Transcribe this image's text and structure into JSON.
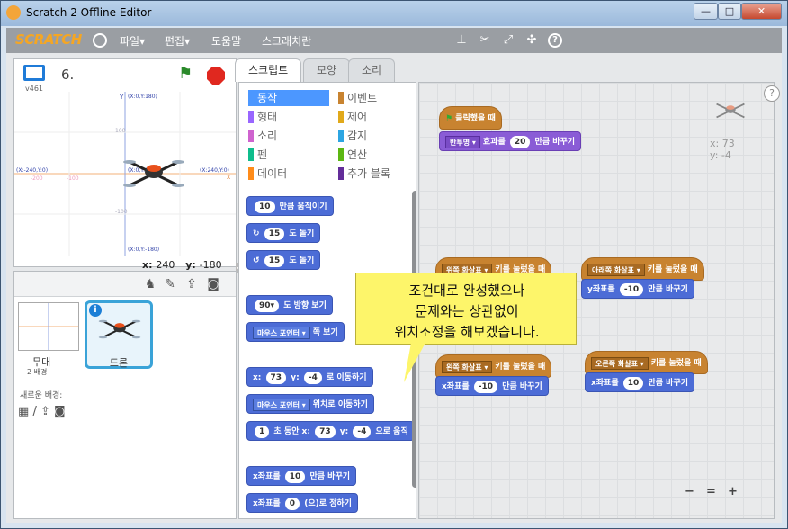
{
  "window": {
    "title": "Scratch 2 Offline Editor",
    "minimize": "—",
    "maximize": "□",
    "close": "✕"
  },
  "menubar": {
    "logo": "SCRATCH",
    "menus": [
      "파일▾",
      "편집▾",
      "도움말",
      "스크래치란"
    ],
    "tool_icons": [
      "stamp-icon",
      "cut-icon",
      "grow-icon",
      "shrink-icon",
      "help-icon"
    ]
  },
  "stage": {
    "version": "v461",
    "project_title": "6.",
    "axis_labels": {
      "top": "(X:0,Y:180)",
      "bottom": "(X:0,Y:-180)",
      "left": "(X:-240,Y:0)",
      "right": "(X:240,Y:0)",
      "center": "(X:0,Y:0)",
      "x_letter": "X",
      "y_letter": "Y",
      "tick_100": "100",
      "tick_n100": "-100",
      "tick_200": "-200"
    },
    "x_label": "x:",
    "x_value": "240",
    "y_label": "y:",
    "y_value": "-180"
  },
  "sprites": {
    "stage_label": "무대",
    "backdrop_count": "2 배경",
    "new_backdrop_label": "새로운 배경:",
    "sprite_name": "드론",
    "info": "i"
  },
  "tabs": [
    "스크립트",
    "모양",
    "소리"
  ],
  "categories": {
    "left": [
      {
        "label": "동작",
        "color": "#4c97ff"
      },
      {
        "label": "형태",
        "color": "#9966ff"
      },
      {
        "label": "소리",
        "color": "#cf63cf"
      },
      {
        "label": "펜",
        "color": "#0fbd8c"
      },
      {
        "label": "데이터",
        "color": "#ff8c1a"
      }
    ],
    "right": [
      {
        "label": "이벤트",
        "color": "#c88330"
      },
      {
        "label": "제어",
        "color": "#e1a91a"
      },
      {
        "label": "감지",
        "color": "#2ca5e2"
      },
      {
        "label": "연산",
        "color": "#5cb712"
      },
      {
        "label": "추가 블록",
        "color": "#632d99"
      }
    ]
  },
  "palette_blocks": {
    "move_num": "10",
    "move_text": "만큼 움직이기",
    "turn_cw_num": "15",
    "turn_cw_text": "도 돌기",
    "turn_ccw_num": "15",
    "turn_ccw_text": "도 돌기",
    "point_dir_num": "90▾",
    "point_dir_text": "도 방향 보기",
    "point_to_drop": "마우스 포인터 ▾",
    "point_to_text": "쪽 보기",
    "goto_x_label": "x:",
    "goto_x": "73",
    "goto_y_label": "y:",
    "goto_y": "-4",
    "goto_text": "로 이동하기",
    "goto_to_drop": "마우스 포인터 ▾",
    "goto_to_text": "위치로 이동하기",
    "glide_num": "1",
    "glide_text1": "초 동안 x:",
    "glide_x": "73",
    "glide_y_label": "y:",
    "glide_y": "-4",
    "glide_text2": "으로 움직",
    "change_x_text1": "x좌표를",
    "change_x_num": "10",
    "change_x_text2": "만큼 바꾸기",
    "set_x_text1": "x좌표를",
    "set_x_num": "0",
    "set_x_text2": "(으)로 정하기"
  },
  "scripts": {
    "flag_hat": "클릭했을 때",
    "set_effect_drop": "반투명 ▾",
    "set_effect_text1": "효과를",
    "set_effect_num": "20",
    "set_effect_text2": "만큼 바꾸기",
    "key_up_drop": "위쪽 화살표 ▾",
    "key_up_text": "키를 눌렀을 때",
    "key_down_drop": "아래쪽 화살표 ▾",
    "key_down_text": "키를 눌렀을 때",
    "key_left_drop": "왼쪽 화살표 ▾",
    "key_left_text": "키를 눌렀을 때",
    "key_right_drop": "오른쪽 화살표 ▾",
    "key_right_text": "키를 눌렀을 때",
    "down_y_text1": "y좌표를",
    "down_y_num": "-10",
    "down_y_text2": "만큼 바꾸기",
    "left_x_text1": "x좌표를",
    "left_x_num": "-10",
    "left_x_text2": "만큼 바꾸기",
    "right_x_text1": "x좌표를",
    "right_x_num": "10",
    "right_x_text2": "만큼 바꾸기",
    "ghost_x": "x: 73",
    "ghost_y": "y: -4"
  },
  "callout": {
    "line1": "조건대로 완성했으나",
    "line2": "문제와는 상관없이",
    "line3": "위치조정을 해보겠습니다."
  },
  "zoom": {
    "zoom_out": "−",
    "reset": "=",
    "zoom_in": "+"
  },
  "help": "?"
}
